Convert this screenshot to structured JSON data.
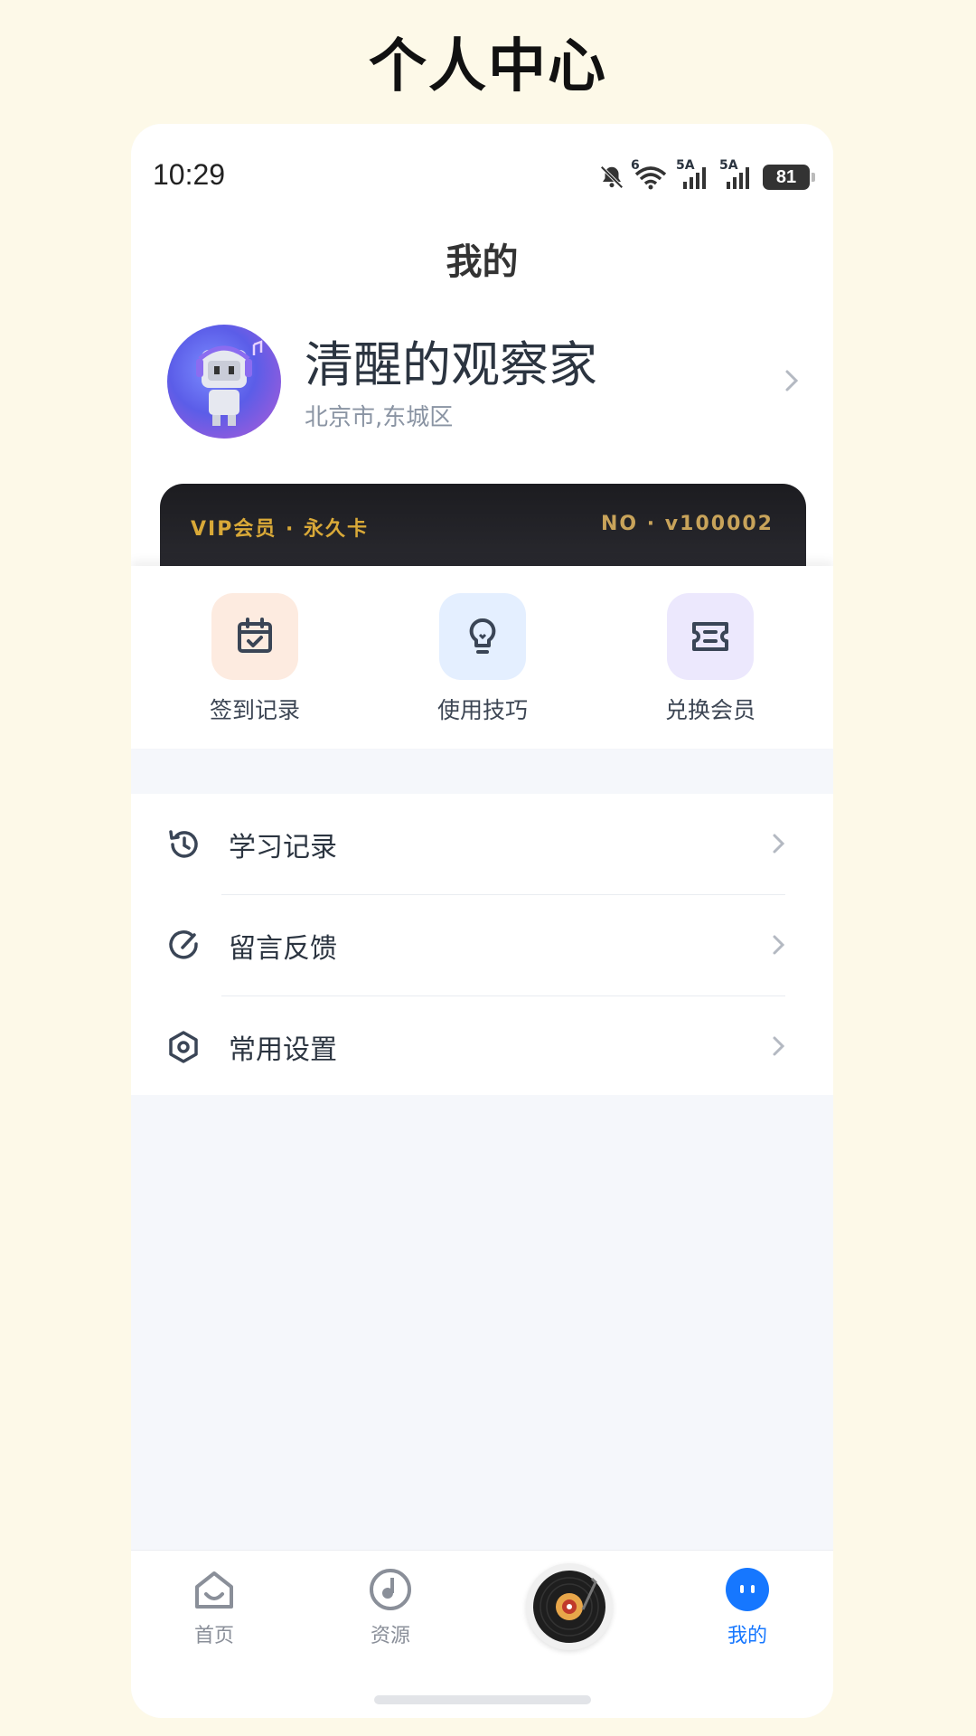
{
  "page_heading": "个人中心",
  "status_bar": {
    "time": "10:29",
    "network1": "6",
    "network2": "5A",
    "network3": "5A",
    "battery": "81"
  },
  "nav": {
    "title": "我的"
  },
  "profile": {
    "name": "清醒的观察家",
    "location": "北京市,东城区"
  },
  "vip": {
    "label": "VIP会员 · 永久卡",
    "number": "NO · v100002",
    "accent": "#d9a938"
  },
  "quick_actions": [
    {
      "label": "签到记录",
      "icon": "calendar-check-icon",
      "bg": "#fdebe0"
    },
    {
      "label": "使用技巧",
      "icon": "lightbulb-icon",
      "bg": "#e4efff"
    },
    {
      "label": "兑换会员",
      "icon": "ticket-icon",
      "bg": "#ece8fd"
    }
  ],
  "menu": [
    {
      "label": "学习记录",
      "icon": "history-icon"
    },
    {
      "label": "留言反馈",
      "icon": "feedback-icon"
    },
    {
      "label": "常用设置",
      "icon": "settings-icon"
    }
  ],
  "tabbar": {
    "items": [
      {
        "label": "首页",
        "icon": "home-icon"
      },
      {
        "label": "资源",
        "icon": "music-note-icon"
      },
      {
        "label": "",
        "icon": "vinyl-disc-icon"
      },
      {
        "label": "我的",
        "icon": "profile-face-icon"
      }
    ],
    "active_color": "#1677ff"
  }
}
